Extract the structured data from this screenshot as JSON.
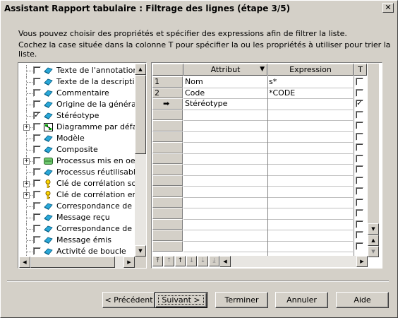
{
  "window": {
    "title": "Assistant Rapport tabulaire : Filtrage des lignes (étape 3/5)",
    "close_label": "✕"
  },
  "instructions": {
    "line1": "Vous pouvez choisir des propriétés et spécifier des expressions afin de filtrer la liste.",
    "line2": "Cochez la case située dans la colonne T pour spécifier la ou les propriétés à utiliser pour trier la liste."
  },
  "tree": {
    "items": [
      {
        "label": "Texte de l'annotation",
        "checked": false,
        "expander": "",
        "icon": "attribute-icon"
      },
      {
        "label": "Texte de la description",
        "checked": false,
        "expander": "",
        "icon": "attribute-icon"
      },
      {
        "label": "Commentaire",
        "checked": false,
        "expander": "",
        "icon": "attribute-icon"
      },
      {
        "label": "Origine de la génération",
        "checked": false,
        "expander": "",
        "icon": "attribute-icon"
      },
      {
        "label": "Stéréotype",
        "checked": true,
        "expander": "",
        "icon": "attribute-icon"
      },
      {
        "label": "Diagramme par défaut",
        "checked": false,
        "expander": "+",
        "icon": "diagram-icon"
      },
      {
        "label": "Modèle",
        "checked": false,
        "expander": "",
        "icon": "attribute-icon"
      },
      {
        "label": "Composite",
        "checked": false,
        "expander": "",
        "icon": "attribute-icon"
      },
      {
        "label": "Processus mis en oeuvre",
        "checked": false,
        "expander": "+",
        "icon": "process-icon"
      },
      {
        "label": "Processus réutilisable",
        "checked": false,
        "expander": "",
        "icon": "attribute-icon"
      },
      {
        "label": "Clé de corrélation sortante",
        "checked": false,
        "expander": "+",
        "icon": "key-icon"
      },
      {
        "label": "Clé de corrélation entrante",
        "checked": false,
        "expander": "+",
        "icon": "key-icon"
      },
      {
        "label": "Correspondance de message",
        "checked": false,
        "expander": "",
        "icon": "attribute-icon"
      },
      {
        "label": "Message reçu",
        "checked": false,
        "expander": "",
        "icon": "attribute-icon"
      },
      {
        "label": "Correspondance de message",
        "checked": false,
        "expander": "",
        "icon": "attribute-icon"
      },
      {
        "label": "Message émis",
        "checked": false,
        "expander": "",
        "icon": "attribute-icon"
      },
      {
        "label": "Activité de boucle",
        "checked": false,
        "expander": "",
        "icon": "attribute-icon"
      }
    ]
  },
  "grid": {
    "columns": {
      "attribut": "Attribut",
      "expression": "Expression",
      "t": "T"
    },
    "rows": [
      {
        "num": "1",
        "attribut": "Nom",
        "expression": "s*",
        "t": false
      },
      {
        "num": "2",
        "attribut": "Code",
        "expression": "*CODE",
        "t": false
      },
      {
        "num": "➡",
        "attribut": "Stéréotype",
        "expression": "",
        "t": true
      }
    ],
    "empty_rows": 13,
    "nav_buttons": [
      "⤒",
      "⇡",
      "↑",
      "↓",
      "⇣",
      "⤓"
    ]
  },
  "buttons": {
    "previous": "< Précédent",
    "next": "Suivant >",
    "finish": "Terminer",
    "cancel": "Annuler",
    "help": "Aide"
  }
}
